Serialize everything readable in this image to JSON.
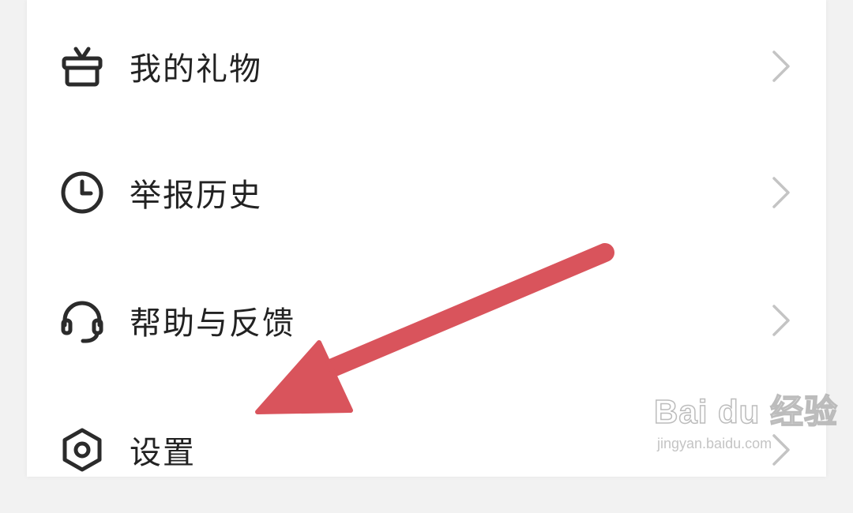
{
  "menu": {
    "items": [
      {
        "label": "我的礼物",
        "icon": "gift-icon"
      },
      {
        "label": "举报历史",
        "icon": "clock-icon"
      },
      {
        "label": "帮助与反馈",
        "icon": "headset-icon"
      },
      {
        "label": "设置",
        "icon": "settings-hexagon-icon"
      }
    ]
  },
  "annotation": {
    "arrow_color": "#d9545c"
  },
  "watermark": {
    "logo": "Bai du 经验",
    "url": "jingyan.baidu.com"
  },
  "colors": {
    "text": "#222222",
    "icon": "#2b2b2b",
    "chevron": "#c4c4c4",
    "background": "#f2f2f2",
    "card": "#ffffff"
  }
}
